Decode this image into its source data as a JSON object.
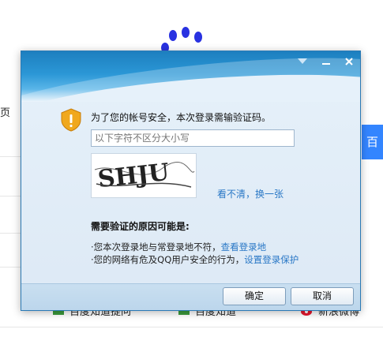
{
  "background": {
    "left_tab_fragment": "页",
    "search_button_fragment": "百",
    "links": [
      {
        "label": "百度知道提问",
        "icon": "baidu-zhidao-icon"
      },
      {
        "label": "百度知道",
        "icon": "baidu-zhidao-icon"
      },
      {
        "label": "新浪微博",
        "icon": "weibo-icon"
      }
    ],
    "logo_color": "#2932e1"
  },
  "dialog": {
    "title_buttons": [
      "menu-arrow-icon",
      "minimize-icon",
      "close-icon"
    ],
    "prompt": "为了您的帐号安全，本次登录需输验证码。",
    "code_input": {
      "value": "",
      "placeholder": "以下字符不区分大小写"
    },
    "captcha_text": "SHJU",
    "refresh_link": "看不清，换一张",
    "reason_title": "需要验证的原因可能是:",
    "reasons": [
      {
        "text": "·您本次登录地与常登录地不符，",
        "link": "查看登录地"
      },
      {
        "text": "·您的网络有危及QQ用户安全的行为，",
        "link": "设置登录保护"
      }
    ],
    "ok_label": "确定",
    "cancel_label": "取消",
    "accent_color": "#2a78c6"
  }
}
